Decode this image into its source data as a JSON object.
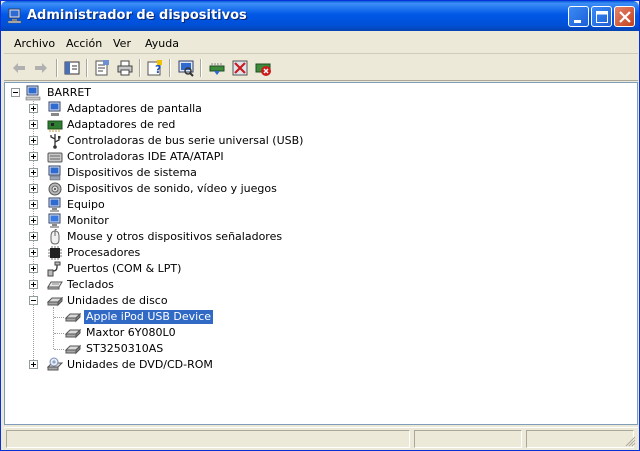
{
  "window": {
    "title": "Administrador de dispositivos",
    "title_icon": "device-manager-icon"
  },
  "menubar": {
    "items": [
      {
        "label": "Archivo"
      },
      {
        "label": "Acción"
      },
      {
        "label": "Ver"
      },
      {
        "label": "Ayuda"
      }
    ]
  },
  "toolbar": {
    "buttons": [
      {
        "icon": "back-arrow-icon"
      },
      {
        "icon": "forward-arrow-icon"
      },
      {
        "icon": "show-hide-tree-icon"
      },
      {
        "icon": "properties-icon"
      },
      {
        "icon": "print-icon"
      },
      {
        "icon": "help-icon"
      },
      {
        "icon": "scan-hardware-icon"
      },
      {
        "icon": "update-driver-icon"
      },
      {
        "icon": "disable-device-icon"
      },
      {
        "icon": "uninstall-device-icon"
      }
    ]
  },
  "tree": {
    "root": {
      "label": "BARRET",
      "icon": "computer-icon",
      "expanded": true
    },
    "categories": [
      {
        "label": "Adaptadores de pantalla",
        "icon": "display-adapter-icon"
      },
      {
        "label": "Adaptadores de red",
        "icon": "network-adapter-icon"
      },
      {
        "label": "Controladoras de bus serie universal (USB)",
        "icon": "usb-icon"
      },
      {
        "label": "Controladoras IDE ATA/ATAPI",
        "icon": "ide-controller-icon"
      },
      {
        "label": "Dispositivos de sistema",
        "icon": "system-device-icon"
      },
      {
        "label": "Dispositivos de sonido, vídeo y juegos",
        "icon": "sound-device-icon"
      },
      {
        "label": "Equipo",
        "icon": "computer-monitor-icon"
      },
      {
        "label": "Monitor",
        "icon": "monitor-icon"
      },
      {
        "label": "Mouse y otros dispositivos señaladores",
        "icon": "mouse-icon"
      },
      {
        "label": "Procesadores",
        "icon": "processor-icon"
      },
      {
        "label": "Puertos (COM & LPT)",
        "icon": "port-icon"
      },
      {
        "label": "Teclados",
        "icon": "keyboard-icon"
      },
      {
        "label": "Unidades de disco",
        "icon": "disk-drive-icon",
        "expanded": true,
        "children": [
          {
            "label": "Apple iPod USB Device",
            "icon": "disk-drive-icon",
            "selected": true
          },
          {
            "label": "Maxtor 6Y080L0",
            "icon": "disk-drive-icon"
          },
          {
            "label": "ST3250310AS",
            "icon": "disk-drive-icon"
          }
        ]
      },
      {
        "label": "Unidades de DVD/CD-ROM",
        "icon": "dvd-drive-icon"
      }
    ]
  },
  "statusbar": {
    "panes": [
      {
        "text": ""
      },
      {
        "text": ""
      },
      {
        "text": ""
      }
    ]
  }
}
